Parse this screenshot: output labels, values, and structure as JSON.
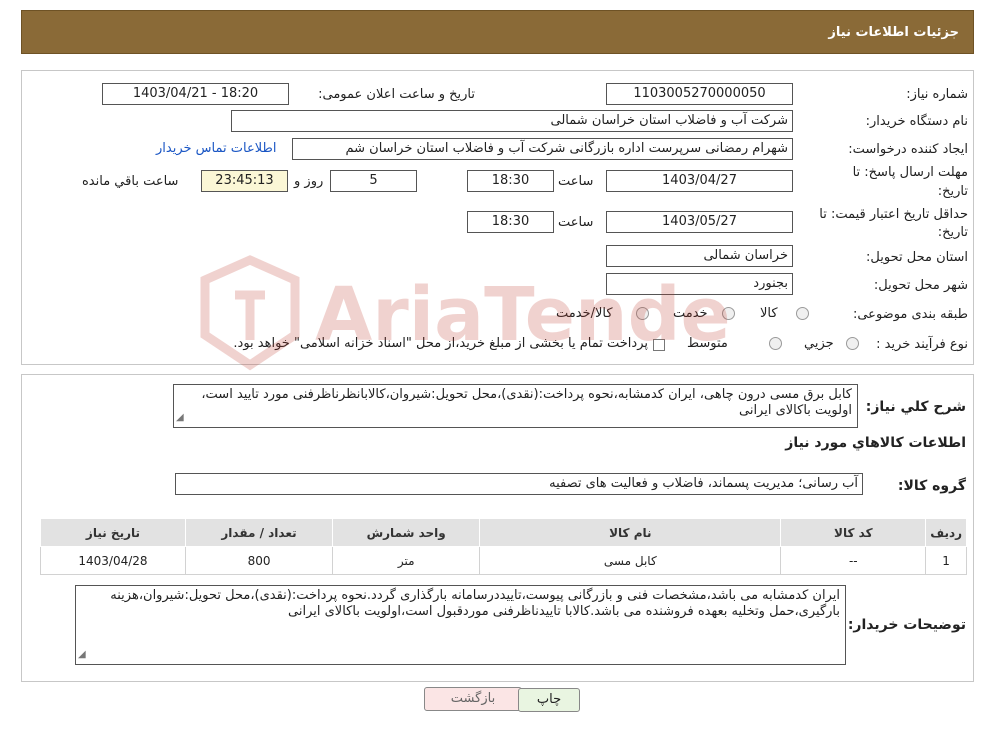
{
  "header": {
    "title": "جزئیات اطلاعات نیاز"
  },
  "labels": {
    "need_number": "شماره نیاز:",
    "announce_datetime": "تاریخ و ساعت اعلان عمومی:",
    "buyer_org": "نام دستگاه خریدار:",
    "requester": "ایجاد کننده درخواست:",
    "reply_deadline_1": "مهلت ارسال پاسخ: تا",
    "reply_deadline_2": "تاریخ:",
    "price_validity_1": "حداقل تاریخ اعتبار قیمت: تا",
    "price_validity_2": "تاریخ:",
    "time": "ساعت",
    "days_and": "روز و",
    "remaining": "ساعت باقي مانده",
    "province": "استان محل تحویل:",
    "city": "شهر محل تحویل:",
    "category": "طبقه بندی موضوعی:",
    "purchase_type": "نوع فرآیند خرید :",
    "need_summary": "شرح کلي نياز:",
    "goods_info": "اطلاعات کالاهاي مورد نياز",
    "goods_group": "گروه کالا:",
    "buyer_notes": "توضیحات خریدار:"
  },
  "values": {
    "need_number": "1103005270000050",
    "announce_datetime": "1403/04/21 - 18:20",
    "buyer_org": "شرکت آب و فاضلاب استان خراسان شمالی",
    "requester": "شهرام رمضانی سرپرست اداره بازرگانی  شرکت آب و فاضلاب استان خراسان شم",
    "contact_link": "اطلاعات تماس خریدار",
    "reply_date": "1403/04/27",
    "reply_time": "18:30",
    "reply_days": "5",
    "reply_remaining": "23:45:13",
    "validity_date": "1403/05/27",
    "validity_time": "18:30",
    "province": "خراسان شمالی",
    "city": "بجنورد",
    "need_summary": "کابل برق مسی درون چاهی، ایران کدمشابه،نحوه پرداخت:(نقدی)،محل تحویل:شیروان،کالابانظرناظرفنی مورد تایید است، اولویت باکالای ایرانی",
    "goods_group": "آب رسانی؛ مدیریت پسماند، فاضلاب و فعالیت های تصفیه",
    "buyer_notes": "ایران کدمشابه می باشد،مشخصات فنی و بازرگانی پیوست،تاییددرسامانه بارگذاری گردد.نحوه پرداخت:(نقدی)،محل تحویل:شیروان،هزینه بارگیری،حمل وتخلیه بعهده فروشنده می باشد.کالابا تاییدناظرفنی موردقبول است،اولویت باکالای ایرانی"
  },
  "category_options": [
    "کالا",
    "خدمت",
    "کالا/خدمت"
  ],
  "purchase_options": [
    "جزیي",
    "متوسط"
  ],
  "purchase_note": "پرداخت تمام یا بخشی از مبلغ خرید،از محل \"اسناد خزانه اسلامی\" خواهد بود.",
  "table": {
    "headers": [
      "ردیف",
      "کد کالا",
      "نام کالا",
      "واحد شمارش",
      "تعداد / مقدار",
      "تاریخ نیاز"
    ],
    "rows": [
      [
        "1",
        "--",
        "کابل مسی",
        "متر",
        "800",
        "1403/04/28"
      ]
    ]
  },
  "buttons": {
    "print": "چاپ",
    "back": "بازگشت"
  },
  "watermark": {
    "text": "AriaTender.neT"
  },
  "colors": {
    "header_bg": "#8a6a37",
    "link": "#1a56c4",
    "watermark": "#c0392b"
  }
}
